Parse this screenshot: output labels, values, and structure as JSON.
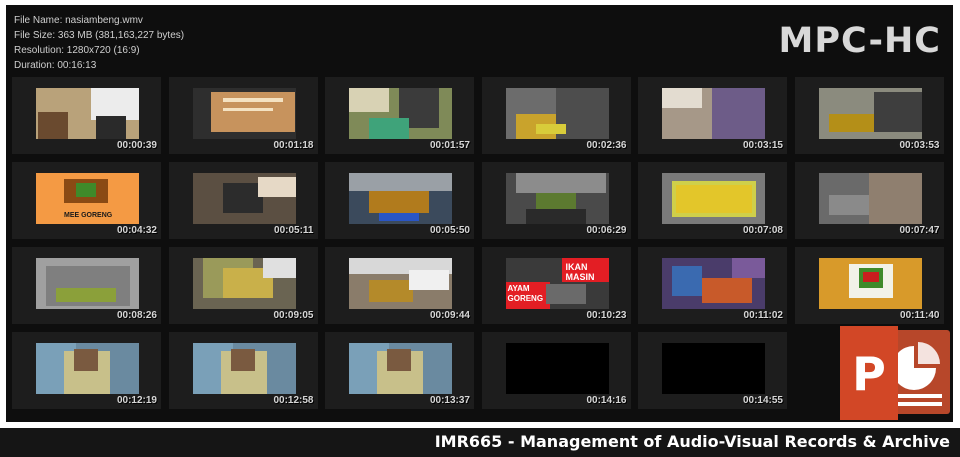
{
  "info": {
    "file_name": "File Name: nasiambeng.wmv",
    "file_size": "File Size: 363 MB (381,163,227 bytes)",
    "resolution": "Resolution: 1280x720 (16:9)",
    "duration": "Duration: 00:16:13"
  },
  "logo": "MPC-HC",
  "captions": {
    "mee_goreng": "MEE GORENG",
    "ikan_masin": "IKAN MASIN",
    "ayam_goreng": "AYAM GORENG"
  },
  "thumbnails": [
    {
      "time": "00:00:39"
    },
    {
      "time": "00:01:18"
    },
    {
      "time": "00:01:57"
    },
    {
      "time": "00:02:36"
    },
    {
      "time": "00:03:15"
    },
    {
      "time": "00:03:53"
    },
    {
      "time": "00:04:32"
    },
    {
      "time": "00:05:11"
    },
    {
      "time": "00:05:50"
    },
    {
      "time": "00:06:29"
    },
    {
      "time": "00:07:08"
    },
    {
      "time": "00:07:47"
    },
    {
      "time": "00:08:26"
    },
    {
      "time": "00:09:05"
    },
    {
      "time": "00:09:44"
    },
    {
      "time": "00:10:23"
    },
    {
      "time": "00:11:02"
    },
    {
      "time": "00:11:40"
    },
    {
      "time": "00:12:19"
    },
    {
      "time": "00:12:58"
    },
    {
      "time": "00:13:37"
    },
    {
      "time": "00:14:16"
    },
    {
      "time": "00:14:55"
    }
  ],
  "footer": "IMR665 - Management of Audio-Visual Records & Archive",
  "colors": {
    "ppt_orange": "#d24726",
    "ppt_dark": "#b7472a",
    "background": "#0e0e0e",
    "cell": "#1d1d1d"
  },
  "icons": {
    "powerpoint": "powerpoint-icon"
  }
}
